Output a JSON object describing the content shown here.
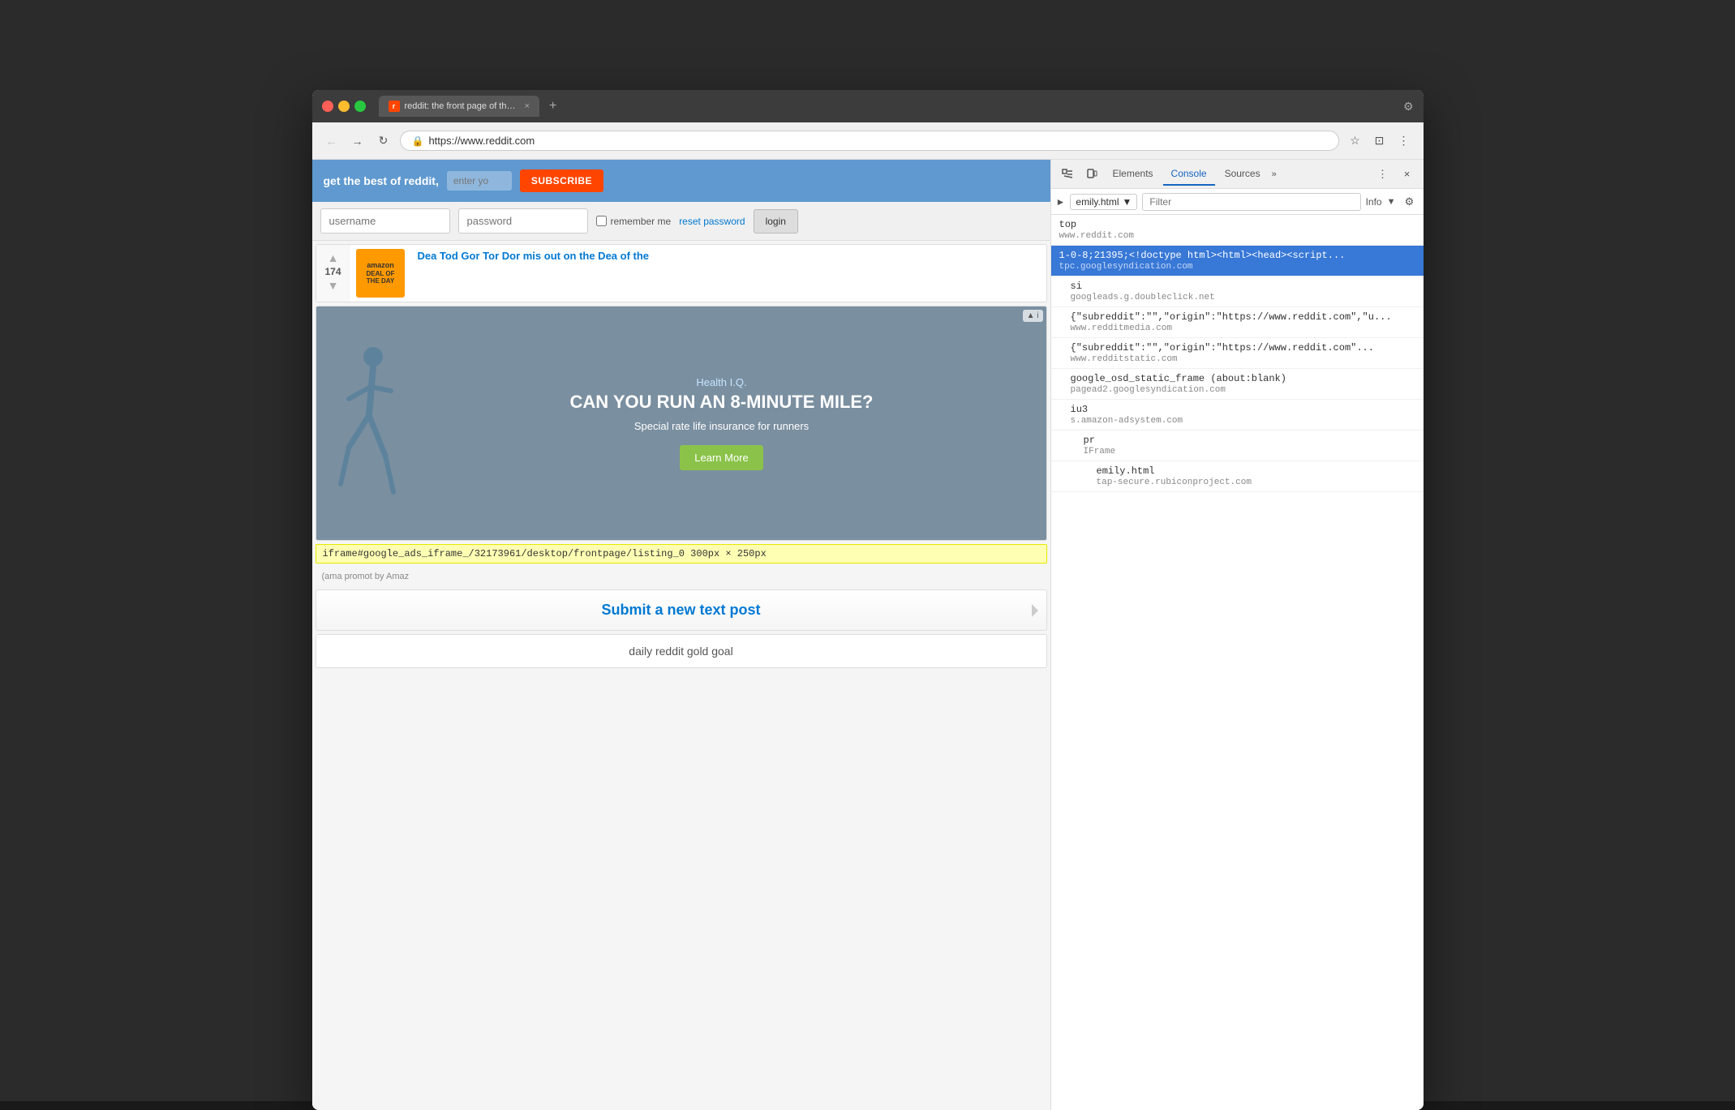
{
  "browser": {
    "url": "https://www.reddit.com",
    "tab_title": "reddit: the front page of the in",
    "tab_favicon": "r"
  },
  "reddit": {
    "topbar_text": "get the best of reddit,",
    "enter_placeholder": "enter yo",
    "subscribe_label": "SUBSCRIBE",
    "login": {
      "username_placeholder": "username",
      "password_placeholder": "password",
      "remember_label": "remember me",
      "reset_label": "reset password",
      "login_label": "login"
    },
    "post": {
      "vote_icon_up": "▲",
      "vote_icon_down": "▼",
      "vote_count": "174",
      "thumbnail_line1": "amazon",
      "thumbnail_line2": "DEAL OF",
      "thumbnail_line3": "THE DAY",
      "title_text": "Dea Tod Gor Tor Dor mis out on the Dea of the",
      "ad_badge": "▲ i",
      "ad_headline": "CAN YOU RUN AN 8-MINUTE MILE?",
      "ad_body": "Special rate life insurance for runners",
      "ad_learn": "Learn More",
      "ad_logo": "Health I.Q."
    },
    "iframe_bar": "iframe#google_ads_iframe_/32173961/desktop/frontpage/listing_0 300px × 250px",
    "submit_post_label": "Submit a new text post",
    "gold_goal_label": "daily reddit gold goal",
    "amazon_promo": "(ama promot by Amaz"
  },
  "devtools": {
    "tabs": [
      "Elements",
      "Console",
      "Sources"
    ],
    "active_tab": "Console",
    "more_label": "»",
    "context_label": "emily.html",
    "filter_placeholder": "Filter",
    "info_label": "Info",
    "close_label": "×",
    "items": [
      {
        "main": "top",
        "sub": "www.reddit.com",
        "selected": false,
        "chevron": false,
        "indent": 0
      },
      {
        "main": "1-0-8;21395;<|doctype html><html><head><script...",
        "sub": "tpc.googlesyndication.com",
        "selected": true,
        "chevron": false,
        "indent": 0
      },
      {
        "main": "si",
        "sub": "googleads.g.doubleclick.net",
        "selected": false,
        "chevron": false,
        "indent": 1
      },
      {
        "main": "{\"subreddit\":\"\",\"origin\":\"https://www.reddit.com\",\"u...",
        "sub": "www.redditmedia.com",
        "selected": false,
        "chevron": false,
        "indent": 1
      },
      {
        "main": "{\"subreddit\":\"\",\"origin\":\"https://www.reddit.com\"...",
        "sub": "www.redditstatic.com",
        "selected": false,
        "chevron": false,
        "indent": 1
      },
      {
        "main": "google_osd_static_frame (about:blank)",
        "sub": "pagead2.googlesyndication.com",
        "selected": false,
        "chevron": false,
        "indent": 1
      },
      {
        "main": "iu3",
        "sub": "s.amazon-adsystem.com",
        "selected": false,
        "chevron": false,
        "indent": 1
      },
      {
        "main": "pr",
        "sub": "IFrame",
        "selected": false,
        "chevron": false,
        "indent": 2
      },
      {
        "main": "emily.html",
        "sub": "tap-secure.rubiconproject.com",
        "selected": false,
        "chevron": false,
        "indent": 3
      }
    ]
  }
}
